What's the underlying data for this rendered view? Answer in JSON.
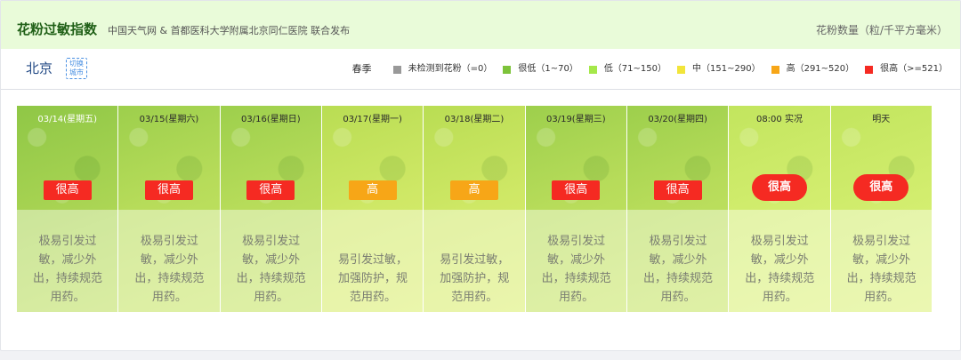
{
  "header": {
    "title": "花粉过敏指数",
    "subtitle": "中国天气网 & 首都医科大学附属北京同仁医院 联合发布",
    "unit": "花粉数量（粒/千平方毫米）"
  },
  "citybar": {
    "city": "北京",
    "switch_label_1": "切换",
    "switch_label_2": "城市"
  },
  "legend": {
    "season": "春季",
    "items": [
      {
        "label": "未检测到花粉（=0）",
        "color": "#999999"
      },
      {
        "label": "很低（1~70）",
        "color": "#7dc33a"
      },
      {
        "label": "低（71~150）",
        "color": "#a5e84a"
      },
      {
        "label": "中（151~290）",
        "color": "#f2e53a"
      },
      {
        "label": "高（291~520）",
        "color": "#f7a617"
      },
      {
        "label": "很高（>=521）",
        "color": "#f52a22"
      }
    ]
  },
  "days": [
    {
      "date": "03/14(星期五)",
      "level": "很高",
      "level_color": "#f52a22",
      "style": "box",
      "desc": "极易引发过敏，减少外出，持续规范用药。"
    },
    {
      "date": "03/15(星期六)",
      "level": "很高",
      "level_color": "#f52a22",
      "style": "box",
      "desc": "极易引发过敏，减少外出，持续规范用药。"
    },
    {
      "date": "03/16(星期日)",
      "level": "很高",
      "level_color": "#f52a22",
      "style": "box",
      "desc": "极易引发过敏，减少外出，持续规范用药。"
    },
    {
      "date": "03/17(星期一)",
      "level": "高",
      "level_color": "#f7a617",
      "style": "box",
      "desc": "易引发过敏，加强防护，规范用药。"
    },
    {
      "date": "03/18(星期二)",
      "level": "高",
      "level_color": "#f7a617",
      "style": "box",
      "desc": "易引发过敏，加强防护，规范用药。"
    },
    {
      "date": "03/19(星期三)",
      "level": "很高",
      "level_color": "#f52a22",
      "style": "box",
      "desc": "极易引发过敏，减少外出，持续规范用药。"
    },
    {
      "date": "03/20(星期四)",
      "level": "很高",
      "level_color": "#f52a22",
      "style": "box",
      "desc": "极易引发过敏，减少外出，持续规范用药。"
    },
    {
      "date": "08:00 实况",
      "level": "很高",
      "level_color": "#f52a22",
      "style": "pill",
      "desc": "极易引发过敏，减少外出，持续规范用药。"
    },
    {
      "date": "明天",
      "level": "很高",
      "level_color": "#f52a22",
      "style": "pill",
      "desc": "极易引发过敏，减少外出，持续规范用药。"
    }
  ]
}
